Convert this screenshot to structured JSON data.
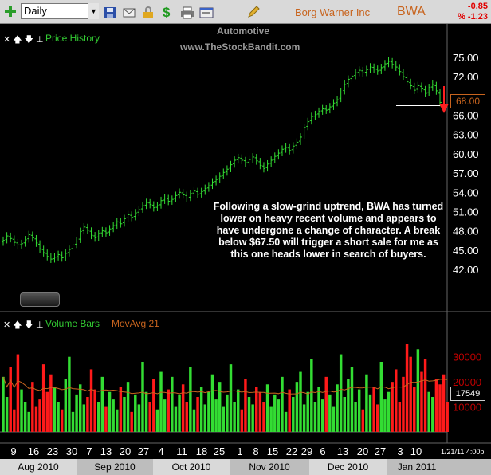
{
  "toolbar": {
    "timeframe": "Daily",
    "company": "Borg Warner Inc",
    "symbol": "BWA",
    "change": "-0.85",
    "change_pct": "% -1.23"
  },
  "price_panel": {
    "title": "Price History",
    "sector": "Automotive",
    "watermark": "www.TheStockBandit.com",
    "annotation": "Following a slow-grind uptrend, BWA has turned lower on heavy recent volume and appears to have undergone a change of character.  A break below $67.50 will trigger a short sale for me as this one heads lower in search of buyers.",
    "last_price": "68.00",
    "controls": "✕ 🡅 🡇 ⊥"
  },
  "volume_panel": {
    "title": "Volume Bars",
    "ma_title": "MovAvg 21",
    "last_ma": "17549",
    "controls": "✕ 🡅 🡇 ⊥"
  },
  "date_readout": "1/21/11 4:00p",
  "months": [
    "Aug 2010",
    "Sep 2010",
    "Oct 2010",
    "Nov 2010",
    "Dec 2010",
    "Jan 2011"
  ],
  "x_ticks": [
    "9",
    "16",
    "23",
    "30",
    "7",
    "13",
    "20",
    "27",
    "4",
    "11",
    "18",
    "25",
    "1",
    "8",
    "15",
    "22",
    "29",
    "6",
    "13",
    "20",
    "27",
    "3",
    "10"
  ],
  "colors": {
    "up": "#33dd33",
    "down": "#ff1a1a",
    "ma": "#c8641e",
    "accent": "#c8641e"
  },
  "chart_data": [
    {
      "type": "ohlc",
      "title": "Price History",
      "y_ticks": [
        42,
        45,
        48,
        51,
        54,
        57,
        60,
        63,
        66,
        69,
        72,
        75
      ],
      "ylim": [
        40,
        77
      ],
      "support_level": 67.5,
      "last": 68.0,
      "closes": [
        46.5,
        47.2,
        46.8,
        46.2,
        45.8,
        46.0,
        46.6,
        47.4,
        46.9,
        46.1,
        45.2,
        44.6,
        44.0,
        43.6,
        43.9,
        44.3,
        43.8,
        44.5,
        45.1,
        45.8,
        46.4,
        47.9,
        48.6,
        48.1,
        47.3,
        46.9,
        47.6,
        48.0,
        47.7,
        48.3,
        48.8,
        49.4,
        49.1,
        49.9,
        50.5,
        50.1,
        50.8,
        51.3,
        51.9,
        52.4,
        52.1,
        51.6,
        51.9,
        52.7,
        53.1,
        52.6,
        52.9,
        53.5,
        54.0,
        53.6,
        53.1,
        53.8,
        54.2,
        53.7,
        54.1,
        54.6,
        55.0,
        55.6,
        56.0,
        56.5,
        57.1,
        57.6,
        58.3,
        59.0,
        59.4,
        59.0,
        58.6,
        59.1,
        59.5,
        58.9,
        58.2,
        57.7,
        58.4,
        59.0,
        59.6,
        60.1,
        60.7,
        61.0,
        60.5,
        61.2,
        61.8,
        62.6,
        64.1,
        65.0,
        65.8,
        66.1,
        66.6,
        67.0,
        66.8,
        67.3,
        67.9,
        68.4,
        69.6,
        70.8,
        71.6,
        72.1,
        72.6,
        73.0,
        72.6,
        73.1,
        73.5,
        73.2,
        72.9,
        73.4,
        74.0,
        74.4,
        73.9,
        73.5,
        72.8,
        72.0,
        71.2,
        70.6,
        69.9,
        70.6,
        70.1,
        69.4,
        70.3,
        70.8,
        69.8,
        68.0
      ]
    },
    {
      "type": "bar",
      "title": "Volume Bars",
      "series_ma": "MovAvg 21",
      "y_ticks": [
        10000,
        20000,
        30000
      ],
      "ylim": [
        0,
        36000
      ],
      "last_ma": 17549,
      "volumes": [
        22000,
        14000,
        26000,
        9000,
        31000,
        17000,
        12000,
        8000,
        20000,
        10000,
        13000,
        27000,
        16000,
        23000,
        18000,
        12000,
        9000,
        21000,
        30000,
        8000,
        15000,
        19000,
        11000,
        14000,
        25000,
        17000,
        12000,
        22000,
        10000,
        16000,
        13000,
        9000,
        18000,
        14000,
        20000,
        8000,
        15000,
        11000,
        28000,
        16000,
        12000,
        21000,
        9000,
        24000,
        13000,
        17000,
        22000,
        10000,
        15000,
        19000,
        12000,
        26000,
        9000,
        14000,
        18000,
        11000,
        16000,
        23000,
        13000,
        20000,
        10000,
        15000,
        27000,
        12000,
        17000,
        9000,
        21000,
        14000,
        11000,
        18000,
        16000,
        12000,
        19000,
        10000,
        15000,
        13000,
        22000,
        8000,
        17000,
        14000,
        20000,
        24000,
        11000,
        16000,
        29000,
        12000,
        18000,
        13000,
        22000,
        15000,
        10000,
        19000,
        31000,
        14000,
        21000,
        26000,
        12000,
        17000,
        9000,
        23000,
        15000,
        18000,
        11000,
        28000,
        13000,
        16000,
        20000,
        25000,
        12000,
        22000,
        35000,
        30000,
        18000,
        33000,
        24000,
        29000,
        16000,
        14000,
        21000,
        19000,
        23000,
        12000
      ]
    }
  ]
}
